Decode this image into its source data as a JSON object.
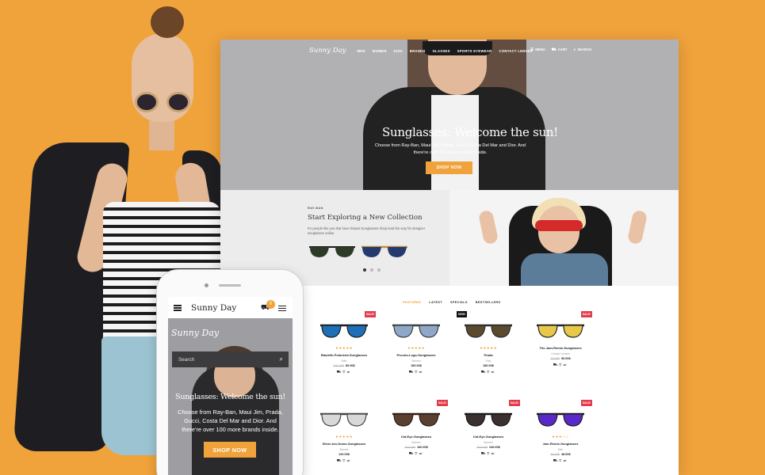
{
  "desktop": {
    "logo": "Sunny Day",
    "nav": [
      "MEN",
      "WOMEN",
      "KIDS",
      "BRANDS",
      "GLASSES",
      "SPORTS EYEWEAR",
      "CONTACT LENSES"
    ],
    "nav_right": {
      "menu": "MENU",
      "cart": "CART",
      "search": "SEARCH"
    },
    "hero": {
      "title": "Sunglasses: Welcome the sun!",
      "subtitle": "Choose from Ray-Ban, Maui Jim, Prada, Gucci, Costa Del Mar and Dior. And there're over 100 more brands inside.",
      "button": "SHOP NOW"
    },
    "collection": {
      "brand": "RAY-BAN",
      "title": "Start Exploring a New Collection",
      "description": "It's people like you that have helped Sunglasses Shop lead the way for designer sunglasses online."
    },
    "tabs": [
      "FEATURED",
      "LATEST",
      "SPECIALS",
      "BESTSELLERS"
    ],
    "products": [
      {
        "name": "Blackfin-Polarized-Sunglasses",
        "brand": "Nike",
        "old_price": "100.00$",
        "price": "80.00$",
        "badge": "SALE!",
        "rating": "★★★★★",
        "lens": "#1e6fb8",
        "frame": "#1a1a1a"
      },
      {
        "name": "Piccolo-Logo-Sunglasses",
        "brand": "Women",
        "old_price": "",
        "price": "180.00$",
        "badge": "",
        "rating": "★★★★★",
        "lens": "#8fa8c8",
        "frame": "#3a3a3a"
      },
      {
        "name": "Prada",
        "brand": "Kids",
        "old_price": "",
        "price": "180.00$",
        "badge": "NEW!",
        "rating": "★★★★★",
        "lens": "#5b4a2e",
        "frame": "#2a2a2a"
      },
      {
        "name": "The-Jam-Remix-Sunglasses",
        "brand": "Contact Lenses",
        "old_price": "70.00$",
        "price": "56.00$",
        "badge": "SALE!",
        "rating": "",
        "lens": "#e8c84a",
        "frame": "#222222"
      },
      {
        "name": "Silver-Ion-Domo-Sunglasses",
        "brand": "Brands",
        "old_price": "",
        "price": "120.00$",
        "badge": "",
        "rating": "★★★★★",
        "lens": "#d8d8d8",
        "frame": "#444444"
      },
      {
        "name": "Cat-Eye-Sunglasses",
        "brand": "Women",
        "old_price": "200.00$",
        "price": "160.00$",
        "badge": "SALE!",
        "rating": "",
        "lens": "#5a4030",
        "frame": "#2b1a12"
      },
      {
        "name": "Cat-Eye-Sunglasses",
        "brand": "Women",
        "old_price": "300.00$",
        "price": "240.00$",
        "badge": "SALE!",
        "rating": "",
        "lens": "#3a3030",
        "frame": "#151515"
      },
      {
        "name": "Jam-Remix-Sunglasses",
        "brand": "Men",
        "old_price": "60.00$",
        "price": "48.00$",
        "badge": "SALE!",
        "rating": "★★★☆☆",
        "lens": "#5a2ac8",
        "frame": "#1a1a1a"
      }
    ]
  },
  "mobile": {
    "logo": "Sunny Day",
    "cart_count": "0",
    "brand_script": "Sunny Day",
    "search_placeholder": "Search",
    "hero_title": "Sunglasses: Welcome the sun!",
    "hero_subtitle": "Choose from Ray-Ban, Maui Jim, Prada, Gucci, Costa Del Mar and Dior. And there're over 100 more brands inside.",
    "button": "SHOP NOW"
  },
  "colors": {
    "background": "#f0a23b",
    "accent": "#f0a23b",
    "sale": "#e23c4c"
  }
}
